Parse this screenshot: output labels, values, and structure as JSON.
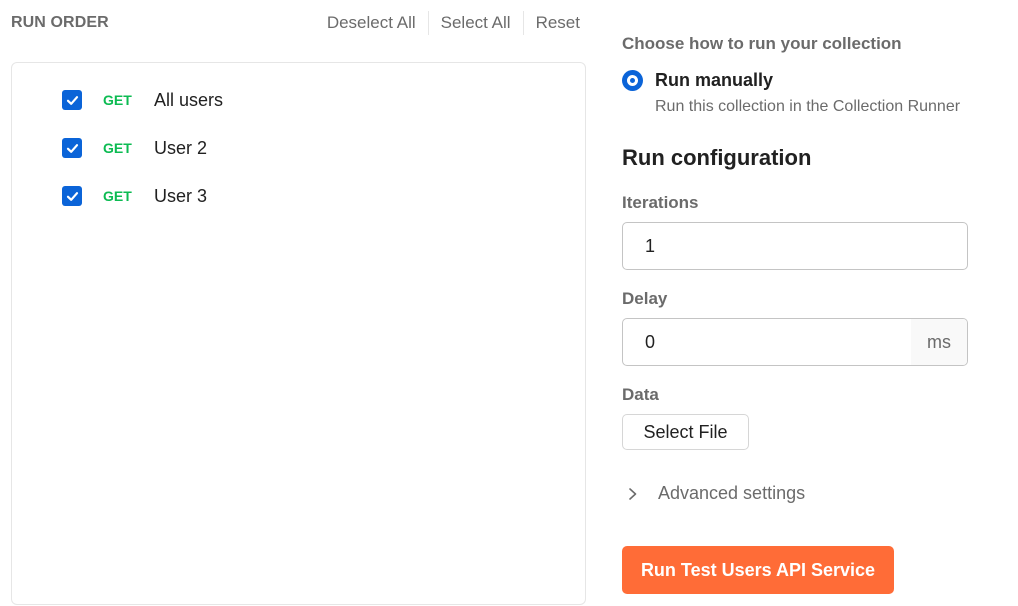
{
  "run_order": {
    "title": "RUN ORDER",
    "actions": {
      "deselect_all": "Deselect All",
      "select_all": "Select All",
      "reset": "Reset"
    },
    "requests": [
      {
        "method": "GET",
        "name": "All users",
        "checked": true
      },
      {
        "method": "GET",
        "name": "User 2",
        "checked": true
      },
      {
        "method": "GET",
        "name": "User 3",
        "checked": true
      }
    ]
  },
  "config": {
    "choose_label": "Choose how to run your collection",
    "run_mode": {
      "label": "Run manually",
      "description": "Run this collection in the Collection Runner",
      "selected": true
    },
    "section_title": "Run configuration",
    "iterations": {
      "label": "Iterations",
      "value": "1"
    },
    "delay": {
      "label": "Delay",
      "value": "0",
      "unit": "ms"
    },
    "data": {
      "label": "Data",
      "button": "Select File"
    },
    "advanced_settings": "Advanced settings",
    "run_button": "Run Test Users API Service"
  },
  "colors": {
    "accent_blue": "#0b64d8",
    "method_get": "#0cbb52",
    "run_button": "#ff6c37"
  }
}
